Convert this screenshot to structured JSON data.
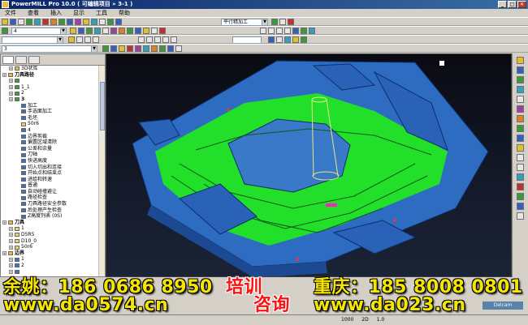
{
  "window": {
    "title": "PowerMILL Pro 10.0   ( 可编辑项目 » 3-1 )",
    "buttons": [
      "_",
      "□",
      "✕"
    ]
  },
  "menu": {
    "items": [
      "文件",
      "查看",
      "插入",
      "显示",
      "工具",
      "帮助"
    ]
  },
  "toolbar": {
    "strategy_combo": "平行精加工",
    "combo_a": "4",
    "combo_b": "3"
  },
  "tree": {
    "items": [
      {
        "label": "3D状库",
        "depth": 1,
        "icon": "folder"
      },
      {
        "label": "刀具路径",
        "depth": 0,
        "icon": "folder",
        "bold": true
      },
      {
        "label": "",
        "depth": 1,
        "icon": "toolpath"
      },
      {
        "label": "1_1",
        "depth": 1,
        "icon": "toolpath"
      },
      {
        "label": "2",
        "depth": 1,
        "icon": "toolpath"
      },
      {
        "label": "3",
        "depth": 1,
        "icon": "toolpath",
        "bold": true
      },
      {
        "label": "加工",
        "depth": 2,
        "icon": "item"
      },
      {
        "label": "手选面加工",
        "depth": 2,
        "icon": "item"
      },
      {
        "label": "毛坯",
        "depth": 2,
        "icon": "item"
      },
      {
        "label": "50r6",
        "depth": 2,
        "icon": "tool"
      },
      {
        "label": "4",
        "depth": 2,
        "icon": "item"
      },
      {
        "label": "边界剪裁",
        "depth": 2,
        "icon": "item"
      },
      {
        "label": "偏置区域清除",
        "depth": 2,
        "icon": "item"
      },
      {
        "label": "公差和余量",
        "depth": 2,
        "icon": "item"
      },
      {
        "label": "刀轴",
        "depth": 2,
        "icon": "item"
      },
      {
        "label": "快进高度",
        "depth": 2,
        "icon": "item"
      },
      {
        "label": "切入切出和连接",
        "depth": 2,
        "icon": "item"
      },
      {
        "label": "开始点和结束点",
        "depth": 2,
        "icon": "item"
      },
      {
        "label": "进给和转速",
        "depth": 2,
        "icon": "item"
      },
      {
        "label": "普通",
        "depth": 2,
        "icon": "item"
      },
      {
        "label": "自动碰撞避让",
        "depth": 2,
        "icon": "item"
      },
      {
        "label": "路径检查",
        "depth": 2,
        "icon": "item"
      },
      {
        "label": "刀具路径安全参数",
        "depth": 2,
        "icon": "item"
      },
      {
        "label": "后处理产生检查",
        "depth": 2,
        "icon": "item"
      },
      {
        "label": "Z高度列表 (0S)",
        "depth": 2,
        "icon": "item"
      },
      {
        "label": "刀具",
        "depth": 0,
        "icon": "folder",
        "bold": true
      },
      {
        "label": "1",
        "depth": 1,
        "icon": "tool"
      },
      {
        "label": "D5R5",
        "depth": 1,
        "icon": "tool"
      },
      {
        "label": "D10_0",
        "depth": 1,
        "icon": "tool"
      },
      {
        "label": "50r6",
        "depth": 1,
        "icon": "tool"
      },
      {
        "label": "边界",
        "depth": 0,
        "icon": "folder",
        "bold": true
      },
      {
        "label": "1",
        "depth": 1,
        "icon": "item"
      },
      {
        "label": "2",
        "depth": 1,
        "icon": "item"
      },
      {
        "label": "",
        "depth": 1,
        "icon": "item"
      }
    ]
  },
  "ads": {
    "line1_left": "余姚：186 0686 8950",
    "line1_mid": "培训",
    "line1_right": "重庆：185 8008 0801",
    "line2_left": "www.da0574.cn",
    "line2_mid": "咨询",
    "line2_right": "www.da023.cn"
  },
  "watermark": "Delcam",
  "statusbar": {
    "left": "",
    "fields": [
      "1000",
      "2D",
      "1.0"
    ]
  },
  "colors": {
    "titlebar": "#0a246a",
    "model_blue": "#3a78c8",
    "toolpath_green": "#22e02a",
    "ad_yellow": "#f5e600",
    "ad_red": "#ff1010"
  }
}
